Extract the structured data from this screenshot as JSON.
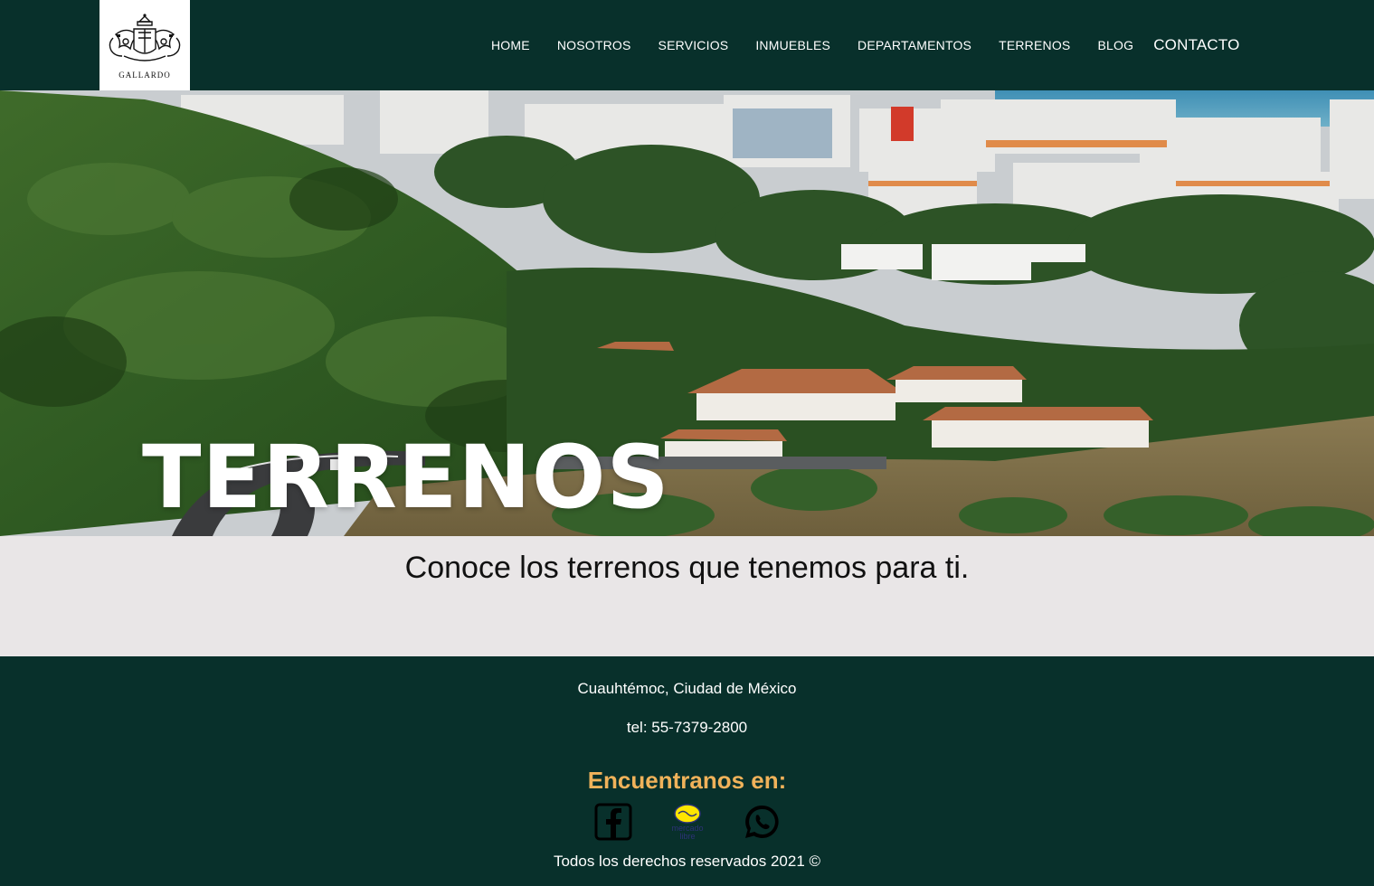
{
  "header": {
    "logo_text": "GALLARDO",
    "nav": [
      "HOME",
      "NOSOTROS",
      "SERVICIOS",
      "INMUEBLES",
      "DEPARTAMENTOS",
      "TERRENOS",
      "BLOG"
    ],
    "contact_label": "CONTACTO"
  },
  "hero": {
    "title": "TERRENOS",
    "image": "city-hillside-photo"
  },
  "intro": {
    "text": "Conoce los terrenos que tenemos para ti."
  },
  "footer": {
    "address": "Cuauhtémoc, Ciudad de México",
    "tel": "tel: 55-7379-2800",
    "find_us": "Encuentranos en:",
    "socials": [
      "facebook-icon",
      "mercado-libre-icon",
      "whatsapp-icon"
    ],
    "mercadolibre_label_1": "mercado",
    "mercadolibre_label_2": "libre",
    "copyright": "Todos los derechos reservados 2021 ©"
  },
  "colors": {
    "dark_green": "#08302b",
    "band": "#e9e6e7",
    "accent": "#f0b25a"
  }
}
